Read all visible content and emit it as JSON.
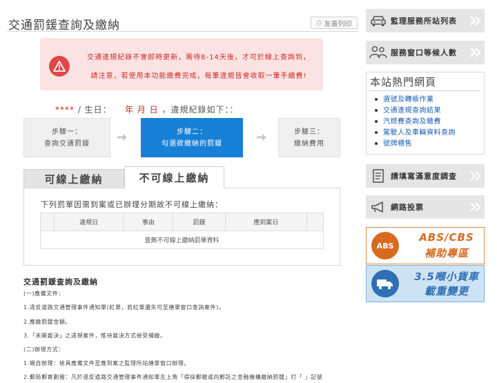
{
  "page": {
    "title": "交通罰鍰查詢及繳納",
    "print_label": "友善列印",
    "icons": {
      "print": "print-icon",
      "warning": "warning-icon"
    }
  },
  "notice": {
    "line1": "交通違規紀錄不會即時更新，需待8-14天後，才可於線上查詢到，",
    "line2": "請注意，若使用本功能繳費完成，每筆違規皆會收取一筆手續費!"
  },
  "identity": {
    "mask": "****",
    "sep": "/ 生日：",
    "year": "年",
    "month": "月",
    "day": "日",
    "suffix": "，違規紀錄如下：："
  },
  "steps": [
    {
      "line1": "步驟一：",
      "line2": "查詢交通罰鍰",
      "state": "inactive"
    },
    {
      "line1": "步驟二：",
      "line2": "勾選欲繳納的罰鍰",
      "state": "active"
    },
    {
      "line1": "步驟三：",
      "line2": "繳納費用",
      "state": "inactive"
    }
  ],
  "tabs": {
    "online": "可線上繳納",
    "offline": "不可線上繳納"
  },
  "panel": {
    "caption": "下列罰單因需到案或已辦理分期故不可線上繳納：",
    "columns": [
      "",
      "違規日",
      "事由",
      "罰鍰",
      "應到案日",
      ""
    ],
    "empty_message": "查無不可線上繳納罰單資料"
  },
  "info": {
    "title": "交通罰鍰查詢及繳納",
    "lines": [
      "(一)應備文件：",
      "1.違反道路交通管理事件通知單(紅單，若紅單遺失可至繕單窗口查詢案件)。",
      "2.應繳罰鍰金額。",
      "3.「未開裁決」之違規案件，惟待裁決方式接受補繳。",
      "(二)辦理方式：",
      "1.親自辦理：檢具應備文件至應到案之監理所站繕單窗口辦理。",
      "2.郵局郵寄劃撥：凡於違反道路交通管理事件通知單左上角「得採郵繳或向郵託之金融機構繳納罰鍰」打「 」記號"
    ]
  },
  "sidebar": {
    "stations_label": "監理服務所站列表",
    "wait_label": "服務窗口等候人數",
    "hot_title": "本站熱門網頁",
    "hot_links": [
      "選號及轉帳作業",
      "交通違規查詢結果",
      "汽燃費查詢及繳費",
      "駕駛人及車輛資料查詢",
      "號牌標售"
    ],
    "survey_label": "請填寫滿意度調查",
    "vote_label": "網路投票",
    "abs_badge": "ABS",
    "abs_line1": "ABS/CBS",
    "abs_line2": "補助專區",
    "truck_line1": "3.5噸小貨車",
    "truck_line2": "載重變更",
    "icons": {
      "stations": "car-icon",
      "wait": "people-icon",
      "survey": "document-icon",
      "vote": "megaphone-icon",
      "chevron": "chevron-right-icon",
      "truck": "truck-icon"
    }
  },
  "colors": {
    "accent_blue": "#1780d6",
    "notice_bg": "#fbe3e3",
    "notice_text": "#d12a2a",
    "abs_orange": "#d86a1f",
    "truck_blue": "#2f6fb4"
  }
}
